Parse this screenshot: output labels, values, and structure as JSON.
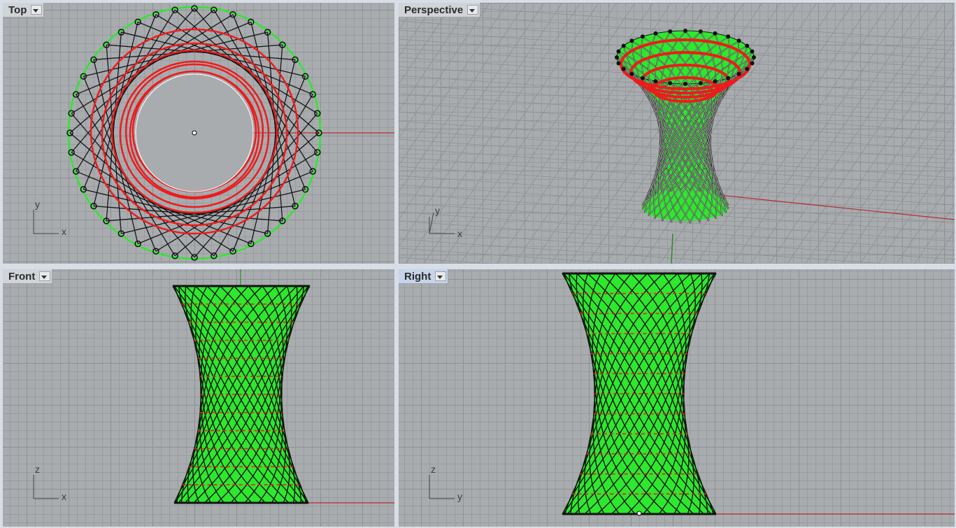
{
  "viewports": {
    "top": {
      "title": "Top",
      "axis_h": "x",
      "axis_v": "y"
    },
    "persp": {
      "title": "Perspective",
      "axis_h": "x",
      "axis_v": "y"
    },
    "front": {
      "title": "Front",
      "axis_h": "x",
      "axis_v": "z"
    },
    "right": {
      "title": "Right",
      "axis_h": "y",
      "axis_v": "z"
    }
  },
  "active_viewport": "Right",
  "colors": {
    "grid_bg": "#a9acaf",
    "surface": "#2ee82e",
    "rods": "#111111",
    "rings": "#ee1b1b",
    "x_axis": "#b13030",
    "y_axis": "#2c8a2c"
  },
  "icons": {
    "viewport_menu": "chevron-down-icon",
    "axis_widget": "axis-triad-icon"
  }
}
